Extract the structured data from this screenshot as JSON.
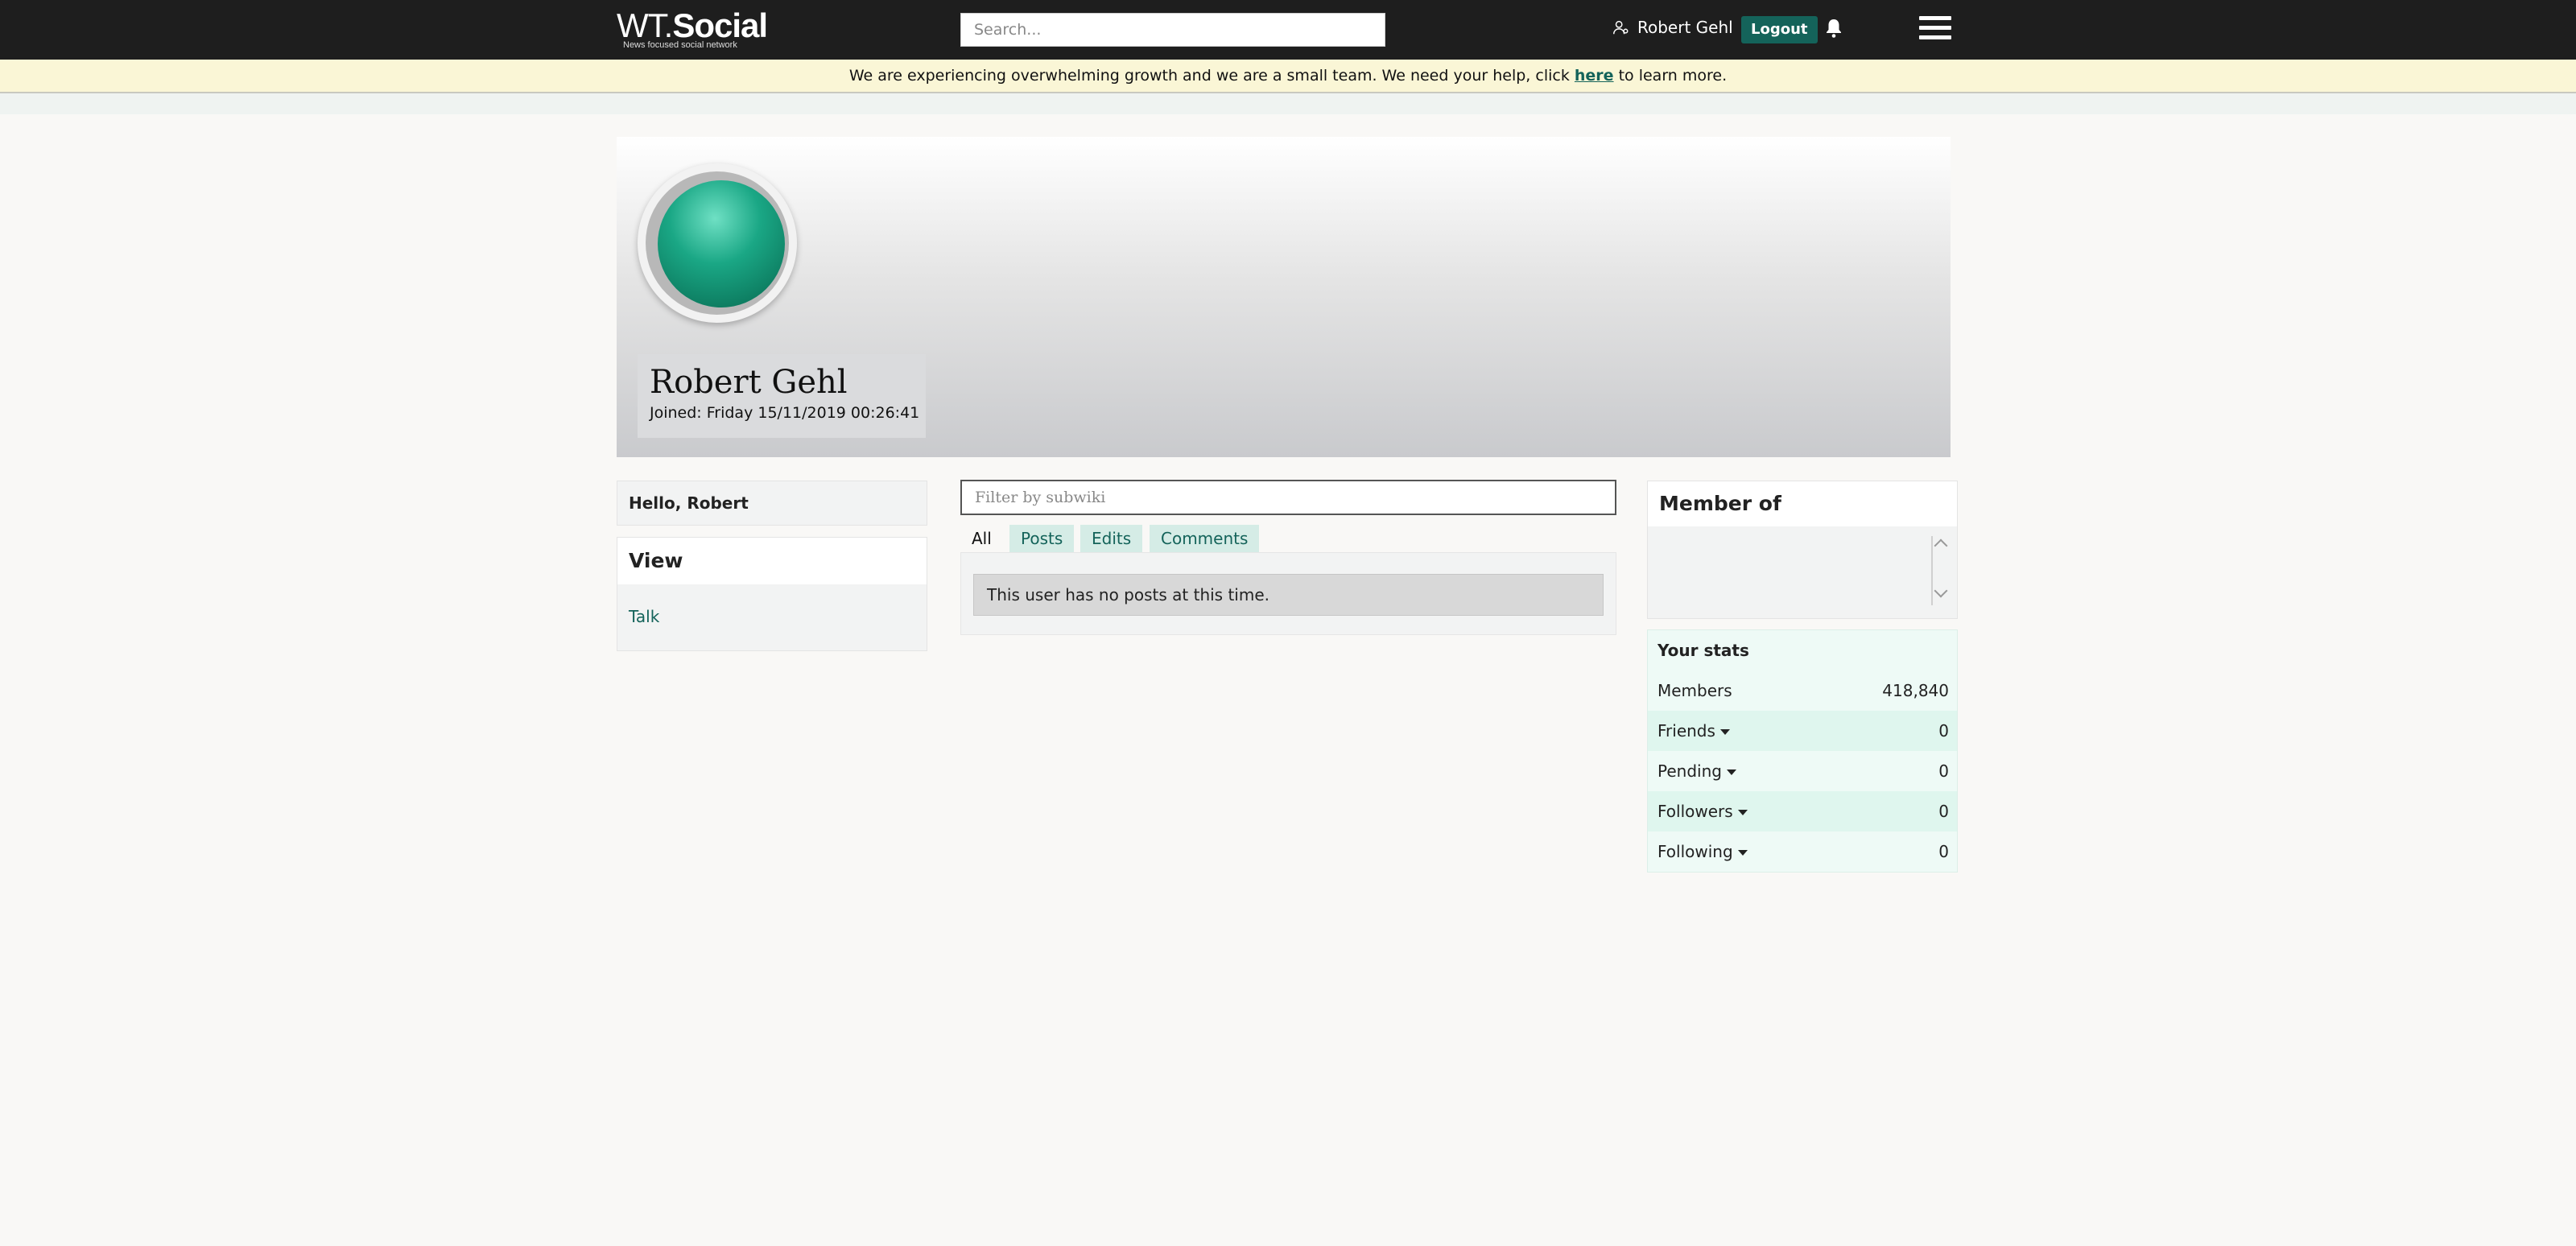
{
  "header": {
    "logo_wt": "WT",
    "logo_dot": ".",
    "logo_social": "Social",
    "logo_tagline": "News focused social network",
    "search_placeholder": "Search...",
    "user_name": "Robert Gehl",
    "logout_label": "Logout",
    "icons": [
      "user-icon",
      "bell-icon",
      "menu-icon"
    ]
  },
  "notice": {
    "text_before": "We are experiencing overwhelming growth and we are a small team. We need your help, click ",
    "link_text": "here",
    "text_after": " to learn more."
  },
  "profile": {
    "name": "Robert Gehl",
    "joined": "Joined: Friday 15/11/2019 00:26:41"
  },
  "left_sidebar": {
    "hello": "Hello, Robert",
    "view_title": "View",
    "view_links": [
      "Talk"
    ]
  },
  "feed": {
    "filter_placeholder": "Filter by subwiki",
    "tabs": [
      {
        "label": "All",
        "active": true
      },
      {
        "label": "Posts",
        "active": false
      },
      {
        "label": "Edits",
        "active": false
      },
      {
        "label": "Comments",
        "active": false
      }
    ],
    "empty_message": "This user has no posts at this time."
  },
  "right_sidebar": {
    "member_of_title": "Member of",
    "stats_title": "Your stats",
    "stats": [
      {
        "label": "Members",
        "value": "418,840",
        "dropdown": false
      },
      {
        "label": "Friends",
        "value": "0",
        "dropdown": true
      },
      {
        "label": "Pending",
        "value": "0",
        "dropdown": true
      },
      {
        "label": "Followers",
        "value": "0",
        "dropdown": true
      },
      {
        "label": "Following",
        "value": "0",
        "dropdown": true
      }
    ]
  },
  "colors": {
    "topbar": "#1e1e1e",
    "accent": "#14635a",
    "notice_bg": "#faf6d6",
    "avatar": "#1aa785"
  }
}
